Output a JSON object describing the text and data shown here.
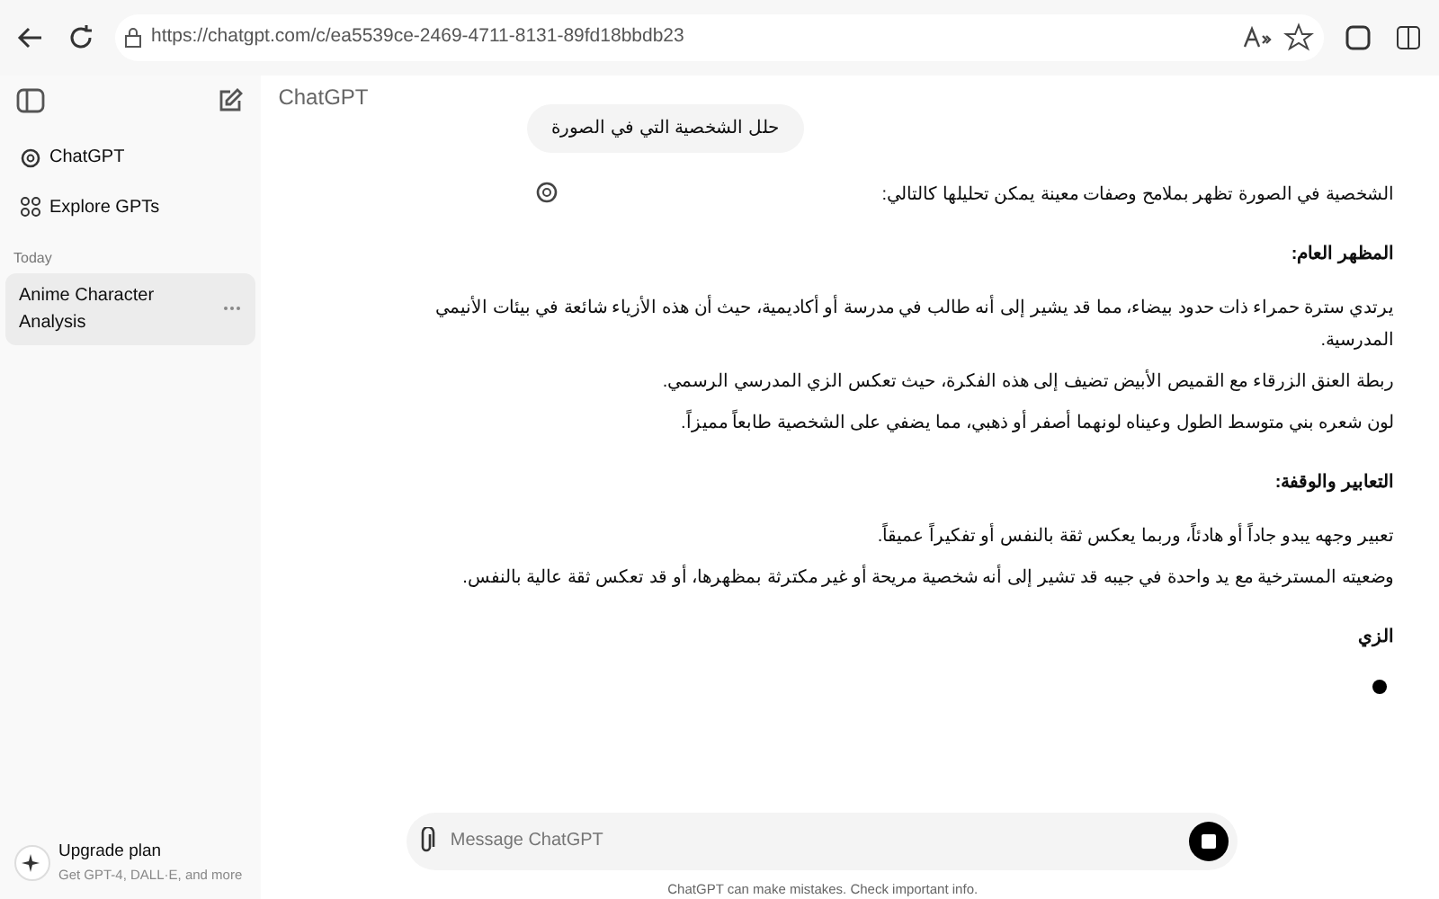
{
  "browser": {
    "url": "https://chatgpt.com/c/ea5539ce-2469-4711-8131-89fd18bbdb23"
  },
  "sidebar": {
    "items": [
      {
        "label": "ChatGPT",
        "kind": "logo"
      },
      {
        "label": "Explore GPTs",
        "kind": "grid"
      }
    ],
    "history": {
      "heading": "Today",
      "items": [
        {
          "label": "Anime Character Analysis",
          "selected": true
        }
      ]
    },
    "upgrade": {
      "title": "Upgrade plan",
      "subtitle": "Get GPT-4, DALL·E, and more"
    }
  },
  "header": {
    "title": "ChatGPT"
  },
  "user_message": "حلل الشخصية التي في الصورة",
  "reply": [
    {
      "kind": "text",
      "text": "الشخصية في الصورة تظهر بملامح وصفات معينة يمكن تحليلها كالتالي:"
    },
    {
      "kind": "heading",
      "text": "المظهر العام:"
    },
    {
      "kind": "text",
      "text": "يرتدي سترة حمراء ذات حدود بيضاء، مما قد يشير إلى أنه طالب في مدرسة أو أكاديمية، حيث أن هذه الأزياء شائعة في بيئات الأنيمي المدرسية."
    },
    {
      "kind": "line",
      "text": "ربطة العنق الزرقاء مع القميص الأبيض تضيف إلى هذه الفكرة، حيث تعكس الزي المدرسي الرسمي."
    },
    {
      "kind": "line",
      "text": "لون شعره بني متوسط الطول وعيناه لونهما أصفر أو ذهبي، مما يضفي على الشخصية طابعاً مميزاً."
    },
    {
      "kind": "heading",
      "text": "التعابير والوقفة:"
    },
    {
      "kind": "text",
      "text": "تعبير وجهه يبدو جاداً أو هادئاً، وربما يعكس ثقة بالنفس أو تفكيراً عميقاً."
    },
    {
      "kind": "line",
      "text": "وضعيته المسترخية مع يد واحدة في جيبه قد تشير إلى أنه شخصية مريحة أو غير مكترثة بمظهرها، أو قد تعكس ثقة عالية بالنفس."
    },
    {
      "kind": "heading",
      "text": "الزي"
    },
    {
      "kind": "cursor"
    }
  ],
  "composer": {
    "placeholder": "Message ChatGPT",
    "generating": true
  },
  "footer": "ChatGPT can make mistakes. Check important info."
}
